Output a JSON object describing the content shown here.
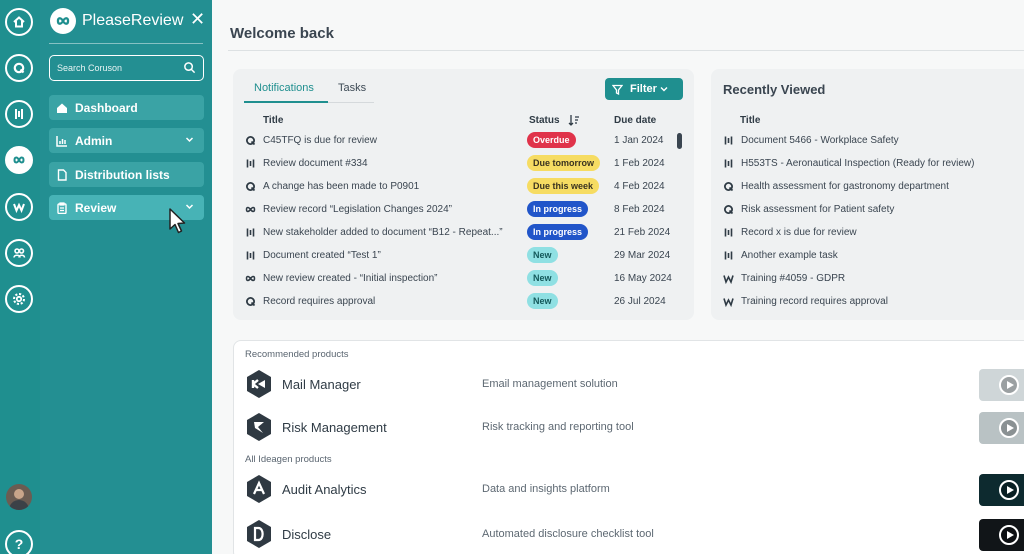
{
  "sidebar": {
    "app_name": "PleaseReview",
    "search_placeholder": "Search Coruson",
    "items": [
      {
        "label": "Dashboard",
        "icon": "home-icon"
      },
      {
        "label": "Admin",
        "icon": "chart-icon"
      },
      {
        "label": "Distribution lists",
        "icon": "document-icon"
      },
      {
        "label": "Review",
        "icon": "clipboard-icon"
      }
    ]
  },
  "rail": {
    "icons": [
      "home-circle-icon",
      "q-circle-icon",
      "bars-circle-icon",
      "please-review-icon",
      "w-circle-icon",
      "people-circle-icon",
      "gear-circle-icon"
    ],
    "help_label": "?"
  },
  "main": {
    "title": "Welcome back",
    "notifications": {
      "tabs": [
        "Notifications",
        "Tasks"
      ],
      "filter_label": "Filter",
      "columns": {
        "title": "Title",
        "status": "Status",
        "due": "Due date"
      },
      "rows": [
        {
          "icon": "q-icon",
          "title": "C45TFQ is due for review",
          "status": "Overdue",
          "status_type": "overdue",
          "due": "1 Jan 2024"
        },
        {
          "icon": "bars-icon",
          "title": "Review document #334",
          "status": "Due tomorrow",
          "status_type": "tomorrow",
          "due": "1 Feb 2024"
        },
        {
          "icon": "q-icon",
          "title": "A change has been made to P0901",
          "status": "Due this week",
          "status_type": "week",
          "due": "4 Feb 2024"
        },
        {
          "icon": "loop-icon",
          "title": "Review record “Legislation Changes 2024”",
          "status": "In progress",
          "status_type": "progress",
          "due": "8 Feb 2024"
        },
        {
          "icon": "bars-icon",
          "title": "New stakeholder added to document “B12 - Repeat...”",
          "status": "In progress",
          "status_type": "progress",
          "due": "21 Feb 2024"
        },
        {
          "icon": "bars-icon",
          "title": "Document created “Test 1”",
          "status": "New",
          "status_type": "new",
          "due": "29 Mar 2024"
        },
        {
          "icon": "loop-icon",
          "title": "New review created - “Initial inspection”",
          "status": "New",
          "status_type": "new",
          "due": "16 May 2024"
        },
        {
          "icon": "q-icon",
          "title": "Record requires approval",
          "status": "New",
          "status_type": "new",
          "due": "26 Jul 2024"
        }
      ]
    },
    "recent": {
      "title": "Recently Viewed",
      "column": "Title",
      "rows": [
        {
          "icon": "bars-icon",
          "title": "Document 5466 - Workplace Safety"
        },
        {
          "icon": "bars-icon",
          "title": "H553TS - Aeronautical Inspection (Ready for review)"
        },
        {
          "icon": "q-icon",
          "title": "Health assessment for gastronomy department"
        },
        {
          "icon": "q-icon",
          "title": "Risk assessment for Patient safety"
        },
        {
          "icon": "bars-icon",
          "title": "Record x is due for review"
        },
        {
          "icon": "bars-icon",
          "title": "Another example task"
        },
        {
          "icon": "w-icon",
          "title": "Training #4059 - GDPR"
        },
        {
          "icon": "w-icon",
          "title": "Training record requires approval"
        }
      ]
    },
    "products": {
      "recommended_label": "Recommended products",
      "all_label": "All Ideagen products",
      "recommended": [
        {
          "name": "Mail Manager",
          "desc": "Email management solution",
          "icon": "mail-manager-icon"
        },
        {
          "name": "Risk Management",
          "desc": "Risk tracking and reporting tool",
          "icon": "risk-management-icon"
        }
      ],
      "all": [
        {
          "name": "Audit Analytics",
          "desc": "Data and insights platform",
          "icon": "audit-analytics-icon"
        },
        {
          "name": "Disclose",
          "desc": "Automated disclosure checklist tool",
          "icon": "disclose-icon"
        }
      ]
    }
  },
  "colors": {
    "teal": "#1f8f8f",
    "overdue": "#e0334a",
    "warning": "#f6dc62",
    "progress": "#2155c9",
    "new": "#8fe0e3"
  }
}
